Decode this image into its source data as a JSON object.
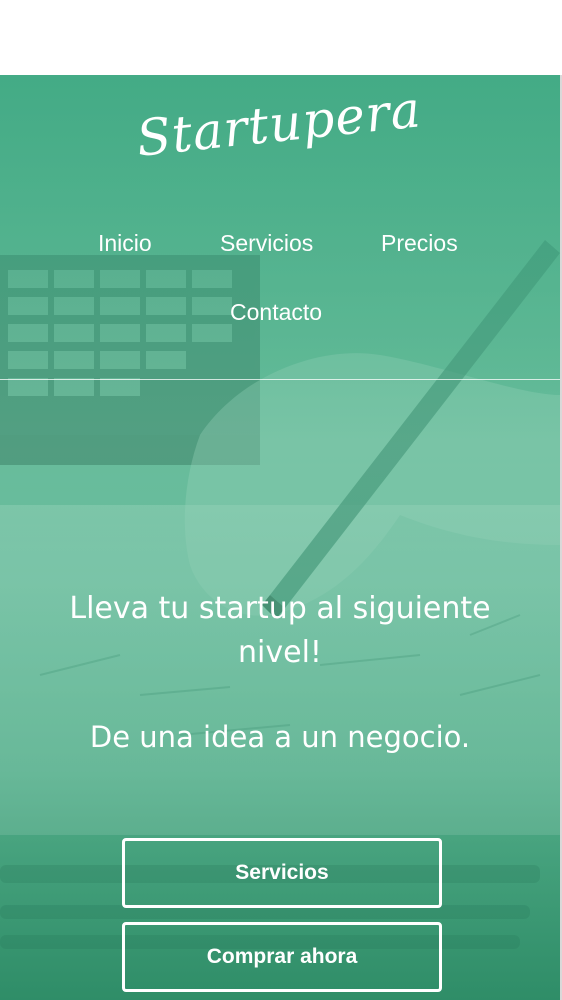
{
  "brand": {
    "logo_text": "Startupera"
  },
  "nav": {
    "items": [
      {
        "label": "Inicio"
      },
      {
        "label": "Servicios"
      },
      {
        "label": "Precios"
      },
      {
        "label": "Contacto"
      }
    ]
  },
  "hero": {
    "headline": "Lleva tu startup al siguiente nivel!",
    "subheadline": "De una idea a un negocio.",
    "buttons": [
      {
        "label": "Servicios"
      },
      {
        "label": "Comprar ahora"
      }
    ]
  },
  "colors": {
    "accent": "#4fb38e",
    "text": "#ffffff"
  }
}
